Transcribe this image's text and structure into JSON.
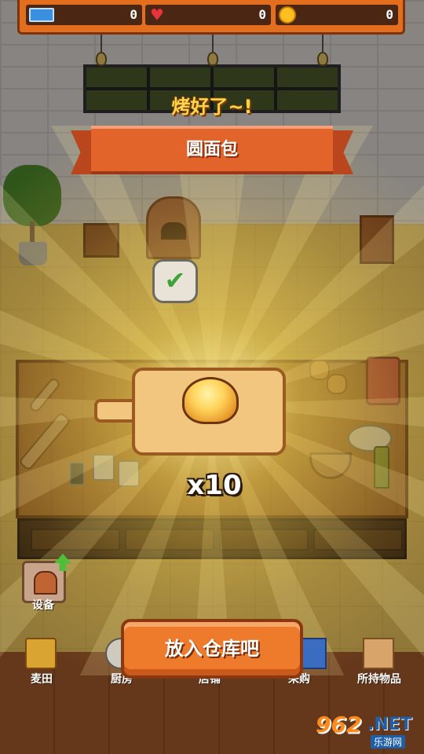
{
  "status": {
    "tickets": "0",
    "hearts": "0",
    "coins": "0",
    "ticket_icon": "ticket-icon",
    "heart_icon": "heart-icon",
    "coin_icon": "coin-icon"
  },
  "result": {
    "headline": "烤好了~!",
    "item_name": "圆面包",
    "quantity": "x10",
    "check_icon": "checkmark-icon"
  },
  "equipment": {
    "label": "设备",
    "icon": "oven-icon",
    "upgrade_icon": "upgrade-arrow-icon"
  },
  "nav": [
    {
      "label": "麦田",
      "icon": "wheat-field-icon"
    },
    {
      "label": "厨房",
      "icon": "kitchen-icon"
    },
    {
      "label": "店铺",
      "icon": "store-icon"
    },
    {
      "label": "采购",
      "icon": "purchase-icon"
    },
    {
      "label": "所持物品",
      "icon": "inventory-box-icon"
    }
  ],
  "action_button": "放入仓库吧",
  "watermark": {
    "num": "962",
    "net": ".NET",
    "cn": "乐游网"
  },
  "colors": {
    "accent_orange": "#e36f1e",
    "ribbon": "#e2642a",
    "headline_yellow": "#ffd54a",
    "check_green": "#3da339"
  }
}
